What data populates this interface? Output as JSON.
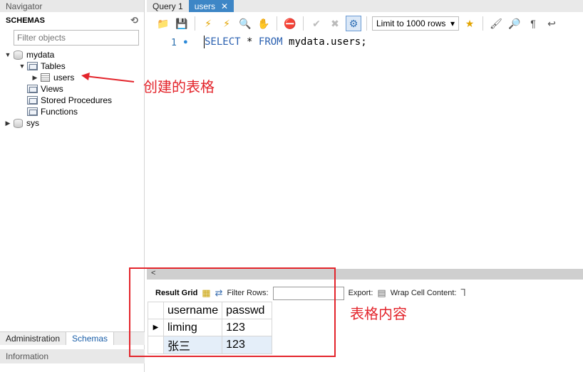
{
  "navigator": {
    "header": "Navigator",
    "schemas_title": "SCHEMAS",
    "filter_placeholder": "Filter objects",
    "tree": {
      "db1": "mydata",
      "tables": "Tables",
      "table1": "users",
      "views": "Views",
      "procedures": "Stored Procedures",
      "functions": "Functions",
      "db2": "sys"
    },
    "tabs": [
      "Administration",
      "Schemas"
    ],
    "info": "Information"
  },
  "editor_tabs": [
    "Query 1",
    "users"
  ],
  "toolbar": {
    "limit": "Limit to 1000 rows"
  },
  "editor": {
    "line_number": "1",
    "sql": {
      "kw1": "SELECT",
      "star": "*",
      "kw2": "FROM",
      "target": "mydata.users;"
    }
  },
  "result_toolbar": {
    "result_grid": "Result Grid",
    "filter_rows": "Filter Rows:",
    "export": "Export:",
    "wrap": "Wrap Cell Content:"
  },
  "grid": {
    "columns": [
      "username",
      "passwd"
    ],
    "rows": [
      [
        "liming",
        "123"
      ],
      [
        "张三",
        "123"
      ]
    ]
  },
  "annotations": {
    "table_created": "创建的表格",
    "table_content": "表格内容"
  },
  "colors": {
    "accent": "#3d86c6",
    "annotation": "#e3242b"
  }
}
